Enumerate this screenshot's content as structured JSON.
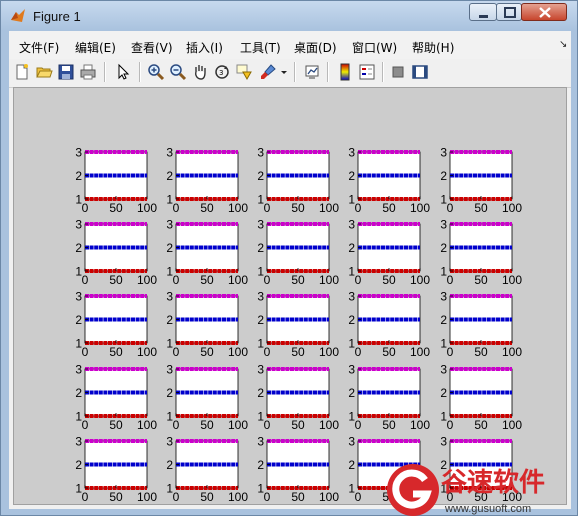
{
  "window": {
    "title": "Figure 1"
  },
  "menu": {
    "items": [
      {
        "label": "文件(F)"
      },
      {
        "label": "编辑(E)"
      },
      {
        "label": "查看(V)"
      },
      {
        "label": "插入(I)"
      },
      {
        "label": "工具(T)"
      },
      {
        "label": "桌面(D)"
      },
      {
        "label": "窗口(W)"
      },
      {
        "label": "帮助(H)"
      }
    ],
    "overflow_glyph": "↘"
  },
  "toolbar": {
    "icons": [
      "new-figure-icon",
      "open-file-icon",
      "save-icon",
      "print-icon",
      "pointer-icon",
      "zoom-in-icon",
      "zoom-out-icon",
      "pan-hand-icon",
      "rotate-3d-icon",
      "data-cursor-icon",
      "brush-icon",
      "link-plot-icon",
      "colorbar-icon",
      "legend-icon",
      "hide-plot-tools-icon",
      "show-plot-tools-icon"
    ]
  },
  "chart_data": {
    "type": "scatter",
    "grid_rows": 5,
    "grid_cols": 5,
    "subplot_count": 25,
    "xlim": [
      0,
      100
    ],
    "ylim": [
      1,
      3
    ],
    "x_ticks": [
      "0",
      "50",
      "100"
    ],
    "y_ticks": [
      "1",
      "2",
      "3"
    ],
    "series": [
      {
        "y": 3,
        "x_range": [
          0,
          100
        ],
        "color": "#cc00cc"
      },
      {
        "y": 2,
        "x_range": [
          0,
          100
        ],
        "color": "#0000cc"
      },
      {
        "y": 1,
        "x_range": [
          0,
          100
        ],
        "color": "#cc0000"
      }
    ],
    "title": "",
    "xlabel": "",
    "ylabel": ""
  },
  "watermark": {
    "brand_text": "谷速软件",
    "url_text": "www.gusuoft.com",
    "accent": "#d7282b"
  },
  "colors": {
    "canvas_bg": "#cccccc",
    "axes_bg": "#ffffff"
  }
}
